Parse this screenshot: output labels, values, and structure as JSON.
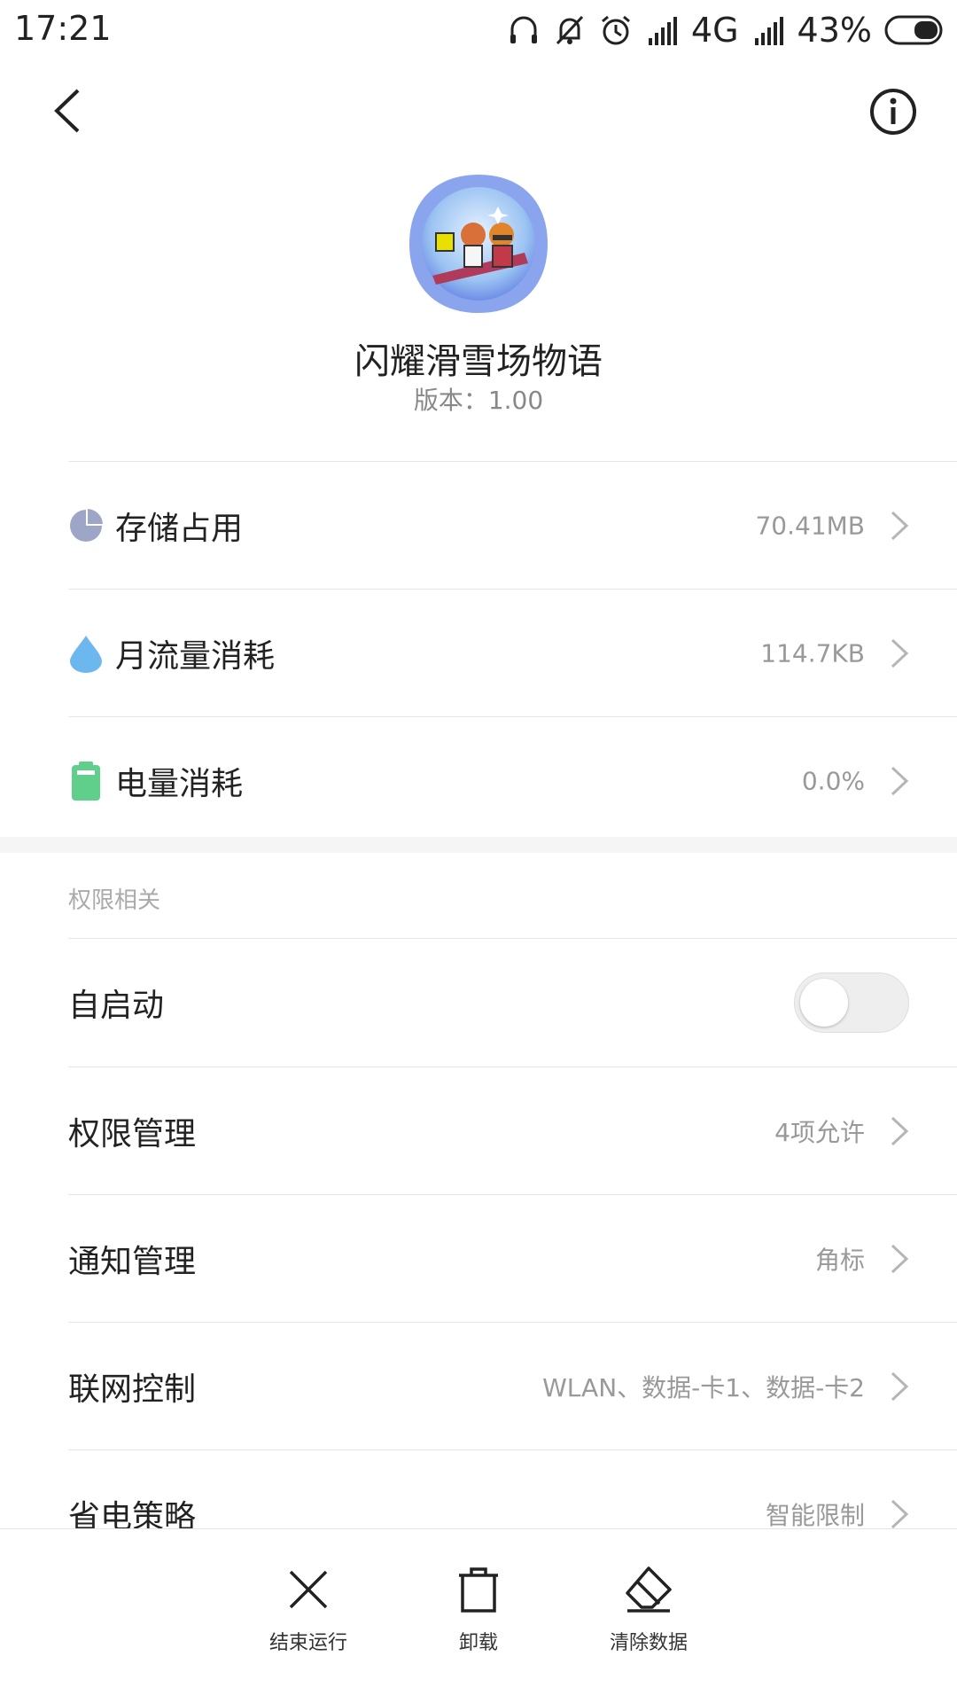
{
  "status_bar": {
    "time": "17:21",
    "network": "4G",
    "battery": "43%"
  },
  "app": {
    "name": "闪耀滑雪场物语",
    "version": "版本：1.00"
  },
  "usage": [
    {
      "label": "存储占用",
      "value": "70.41MB",
      "icon": "pie-chart-icon"
    },
    {
      "label": "月流量消耗",
      "value": "114.7KB",
      "icon": "water-drop-icon"
    },
    {
      "label": "电量消耗",
      "value": "0.0%",
      "icon": "battery-icon"
    }
  ],
  "permissions": {
    "section_title": "权限相关",
    "autostart_label": "自启动",
    "autostart_on": false,
    "items": [
      {
        "label": "权限管理",
        "value": "4项允许"
      },
      {
        "label": "通知管理",
        "value": "角标"
      },
      {
        "label": "联网控制",
        "value": "WLAN、数据-卡1、数据-卡2"
      },
      {
        "label": "省电策略",
        "value": "智能限制"
      }
    ]
  },
  "bottom_actions": [
    {
      "label": "结束运行",
      "icon": "close-icon"
    },
    {
      "label": "卸载",
      "icon": "trash-icon"
    },
    {
      "label": "清除数据",
      "icon": "eraser-icon"
    }
  ],
  "colors": {
    "storage_icon": "#9ea6c8",
    "traffic_icon": "#6cb8ee",
    "battery_icon": "#5fcf8b"
  }
}
